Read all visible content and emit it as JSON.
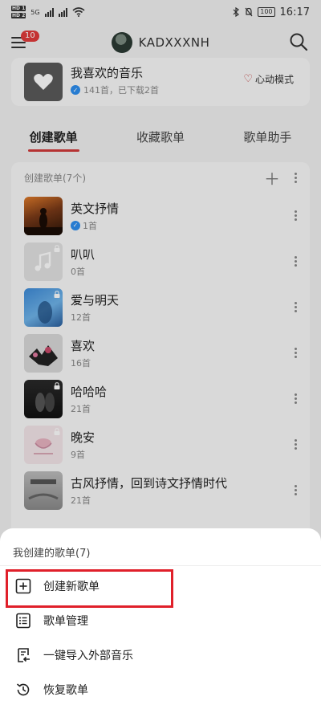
{
  "status_bar": {
    "hd1": "HD 1",
    "hd2": "HD 2",
    "network": "5G",
    "battery": "100",
    "time": "16:17"
  },
  "header": {
    "menu_badge": "10",
    "username": "KADXXXNH"
  },
  "liked_card": {
    "title": "我喜欢的音乐",
    "subtitle": "141首，已下载2首",
    "heart_mode_label": "心动模式"
  },
  "tabs": [
    {
      "label": "创建歌单",
      "active": true
    },
    {
      "label": "收藏歌单",
      "active": false
    },
    {
      "label": "歌单助手",
      "active": false
    }
  ],
  "playlist_section": {
    "header": "创建歌单(7个)",
    "items": [
      {
        "name": "英文抒情",
        "count": "1首",
        "verified": true,
        "locked": false,
        "cover": "cover-sunset"
      },
      {
        "name": "叭叭",
        "count": "0首",
        "verified": false,
        "locked": true,
        "cover": "cover-empty"
      },
      {
        "name": "爱与明天",
        "count": "12首",
        "verified": false,
        "locked": true,
        "cover": "cover-blue"
      },
      {
        "name": "喜欢",
        "count": "16首",
        "verified": false,
        "locked": false,
        "cover": "cover-birds"
      },
      {
        "name": "哈哈哈",
        "count": "21首",
        "verified": false,
        "locked": true,
        "cover": "cover-dark"
      },
      {
        "name": "晚安",
        "count": "9首",
        "verified": false,
        "locked": true,
        "cover": "cover-pink"
      },
      {
        "name": "古风抒情，回到诗文抒情时代",
        "count": "21首",
        "verified": false,
        "locked": false,
        "cover": "cover-gray"
      }
    ]
  },
  "bottom_sheet": {
    "title": "我创建的歌单(7)",
    "items": [
      {
        "label": "创建新歌单",
        "icon": "plus-square-icon"
      },
      {
        "label": "歌单管理",
        "icon": "list-manage-icon"
      },
      {
        "label": "一键导入外部音乐",
        "icon": "import-icon"
      },
      {
        "label": "恢复歌单",
        "icon": "restore-icon"
      }
    ]
  },
  "colors": {
    "accent_red": "#d23b3b",
    "highlight_red": "#e0202a",
    "verified_blue": "#2d8ff0"
  }
}
